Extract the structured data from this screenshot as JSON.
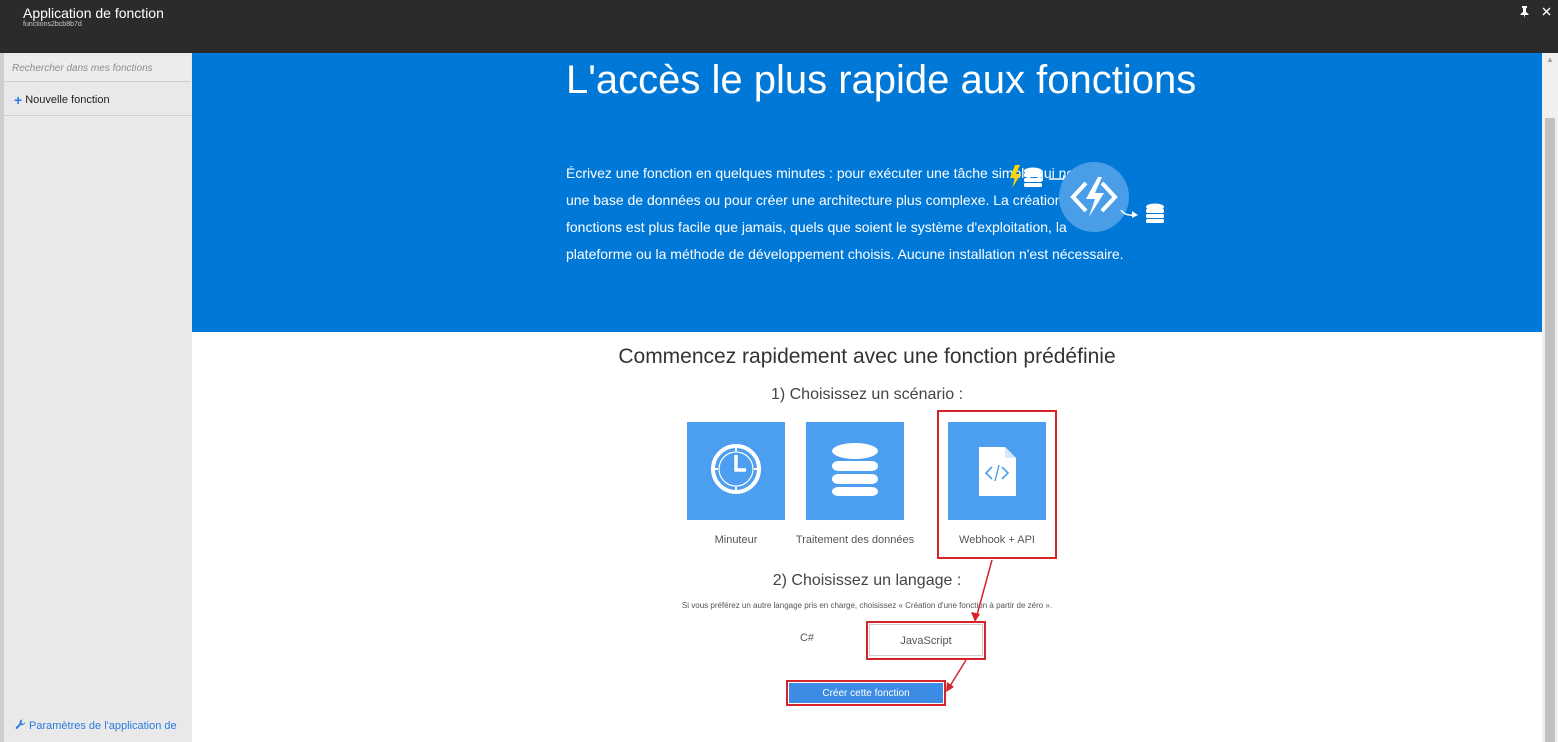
{
  "header": {
    "title": "Application de fonction",
    "subtitle": "functions2bcb8b7d",
    "pin_icon": "pin-icon",
    "close_icon": "close-icon"
  },
  "sidebar": {
    "search_placeholder": "Rechercher dans mes fonctions",
    "new_function_label": "Nouvelle fonction",
    "settings_label": "Paramètres de l'application de",
    "icons": {
      "new": "plus-icon",
      "settings": "wrench-icon"
    }
  },
  "hero": {
    "title": "L'accès le plus rapide aux fonctions",
    "description": "Écrivez une fonction en quelques minutes : pour exécuter une tâche simple qui nettoie une base de données ou pour créer une architecture plus complexe. La création de fonctions est plus facile que jamais, quels que soient le système d'exploitation, la plateforme ou la méthode de développement choisis. Aucune installation n'est nécessaire.",
    "background_color": "#0078d7"
  },
  "quickstart": {
    "title": "Commencez rapidement avec une fonction prédéfinie",
    "step1_label": "1) Choisissez un scénario :",
    "scenarios": [
      {
        "label": "Minuteur",
        "icon": "clock-icon",
        "selected": false
      },
      {
        "label": "Traitement des données",
        "icon": "database-icon",
        "selected": false
      },
      {
        "label": "Webhook + API",
        "icon": "code-document-icon",
        "selected": true
      }
    ],
    "step2_label": "2) Choisissez un langage :",
    "step2_hint": "Si vous préférez un autre langage pris en charge, choisissez « Création d'une fonction à partir de zéro ».",
    "languages": [
      {
        "label": "C#",
        "selected": false
      },
      {
        "label": "JavaScript",
        "selected": true
      }
    ],
    "create_button_label": "Créer cette fonction"
  },
  "colors": {
    "tile": "#4c9ef0",
    "highlight": "#d5252a",
    "button": "#3c8ce6",
    "link": "#2a7bde"
  }
}
